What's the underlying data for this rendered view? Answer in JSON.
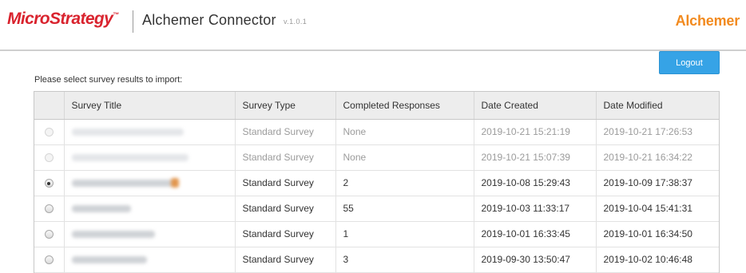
{
  "header": {
    "brand": "MicroStrategy",
    "trademark": "™",
    "title": "Alchemer Connector",
    "version": "v.1.0.1",
    "partner_brand": "Alchemer"
  },
  "actions": {
    "logout_label": "Logout"
  },
  "prompt": "Please select survey results to import:",
  "table": {
    "columns": [
      "",
      "Survey Title",
      "Survey Type",
      "Completed Responses",
      "Date Created",
      "Date Modified"
    ],
    "rows": [
      {
        "selected": false,
        "disabled": true,
        "title": "",
        "type": "Standard Survey",
        "completed": "None",
        "created": "2019-10-21 15:21:19",
        "modified": "2019-10-21 17:26:53"
      },
      {
        "selected": false,
        "disabled": true,
        "title": "",
        "type": "Standard Survey",
        "completed": "None",
        "created": "2019-10-21 15:07:39",
        "modified": "2019-10-21 16:34:22"
      },
      {
        "selected": true,
        "disabled": false,
        "title": "",
        "type": "Standard Survey",
        "completed": "2",
        "created": "2019-10-08 15:29:43",
        "modified": "2019-10-09 17:38:37"
      },
      {
        "selected": false,
        "disabled": false,
        "title": "",
        "type": "Standard Survey",
        "completed": "55",
        "created": "2019-10-03 11:33:17",
        "modified": "2019-10-04 15:41:31"
      },
      {
        "selected": false,
        "disabled": false,
        "title": "",
        "type": "Standard Survey",
        "completed": "1",
        "created": "2019-10-01 16:33:45",
        "modified": "2019-10-01 16:34:50"
      },
      {
        "selected": false,
        "disabled": false,
        "title": "",
        "type": "Standard Survey",
        "completed": "3",
        "created": "2019-09-30 13:50:47",
        "modified": "2019-10-02 10:46:48"
      }
    ]
  },
  "colors": {
    "brand_red": "#d9232e",
    "partner_orange": "#f28a1e",
    "button_blue": "#36a3e6"
  }
}
